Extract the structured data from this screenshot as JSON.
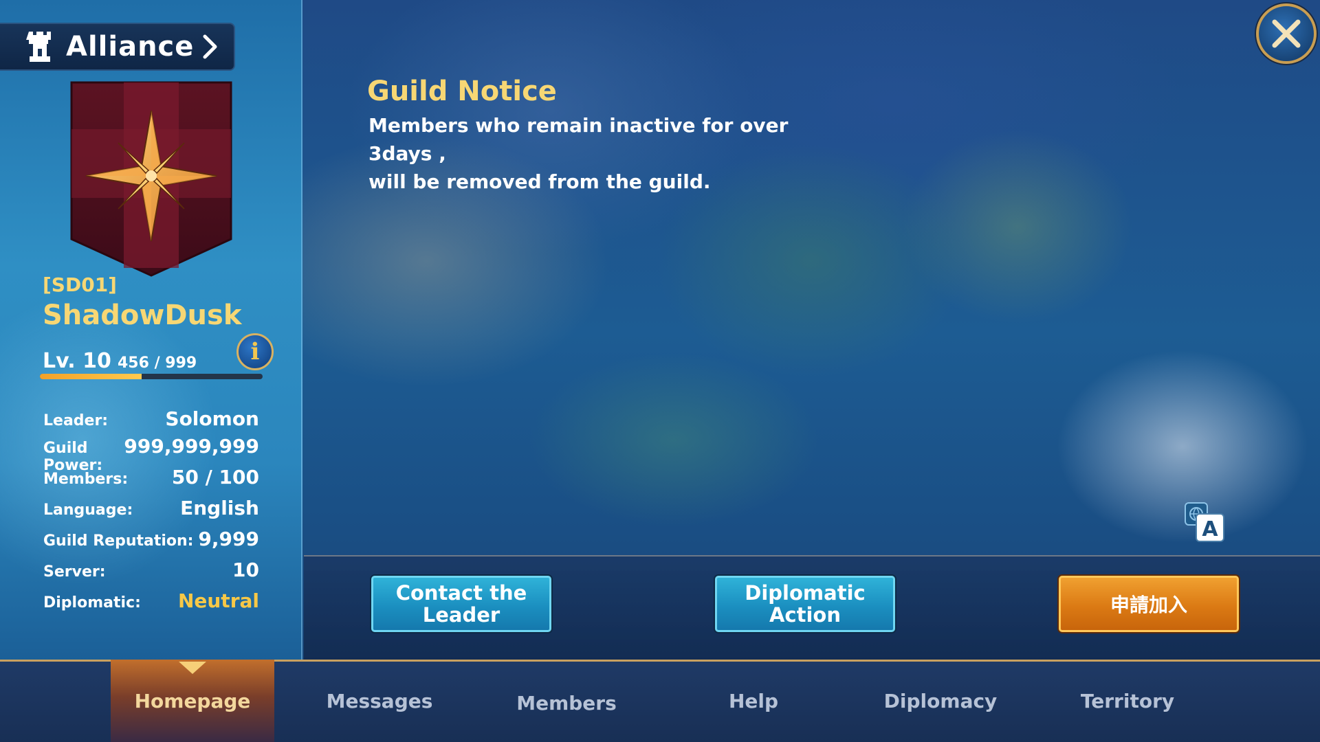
{
  "header": {
    "title": "Alliance"
  },
  "guild": {
    "tag": "[SD01]",
    "name": "ShadowDusk",
    "level_label": "Lv. 10",
    "xp_text": "456 / 999",
    "xp_progress": 0.456
  },
  "stats": [
    {
      "label": "Leader:",
      "value": "Solomon",
      "highlight": false
    },
    {
      "label": "Guild Power:",
      "value": "999,999,999",
      "highlight": false
    },
    {
      "label": "Members:",
      "value": "50 / 100",
      "highlight": false
    },
    {
      "label": "Language:",
      "value": "English",
      "highlight": false
    },
    {
      "label": "Guild Reputation:",
      "value": "9,999",
      "highlight": false
    },
    {
      "label": "Server:",
      "value": "10",
      "highlight": false
    },
    {
      "label": "Diplomatic:",
      "value": "Neutral",
      "highlight": true
    }
  ],
  "notice": {
    "title": "Guild Notice",
    "line1": "Members who remain inactive for over 3days ,",
    "line2": "will be removed from the guild."
  },
  "actions": {
    "contact_line1": "Contact the",
    "contact_line2": "Leader",
    "diplomatic_line1": "Diplomatic",
    "diplomatic_line2": "Action",
    "join": "申請加入"
  },
  "tabs": [
    {
      "label": "Homepage",
      "active": true
    },
    {
      "label": "Messages",
      "active": false
    },
    {
      "label": "Members",
      "active": false
    },
    {
      "label": "Help",
      "active": false
    },
    {
      "label": "Diplomacy",
      "active": false
    },
    {
      "label": "Territory",
      "active": false
    }
  ],
  "icons": {
    "header": "tower-icon",
    "header_arrow": "chevron-right-icon",
    "emblem": "compass-star-emblem",
    "info": "info-icon",
    "translate": "translate-icon",
    "close": "close-icon"
  },
  "colors": {
    "gold_text": "#f7d774",
    "accent_orange": "#db7a14",
    "button_blue": "#1b8fc0",
    "diplomatic_status": "#f7c847"
  }
}
